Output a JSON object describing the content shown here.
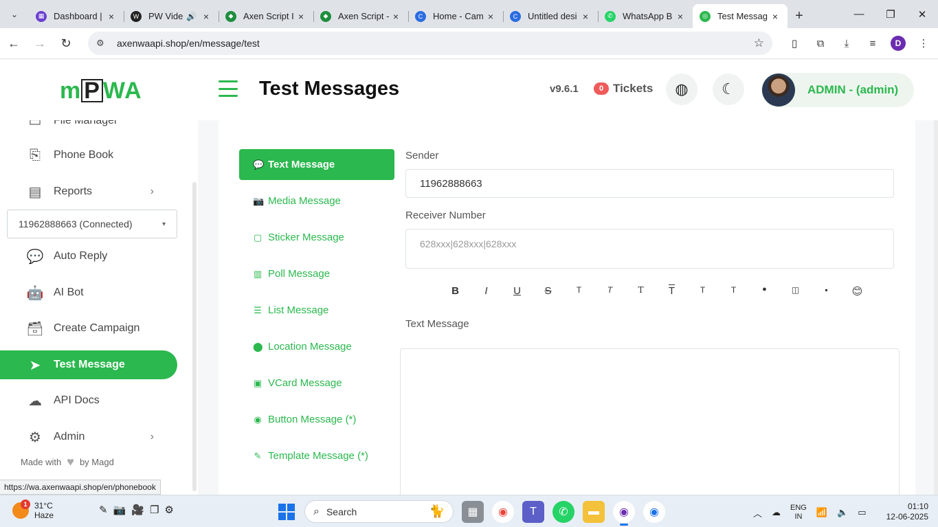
{
  "browser": {
    "tabs": [
      {
        "title": "Dashboard |",
        "color": "#6b3fd1",
        "glyph": "▦"
      },
      {
        "title": "PW Vide",
        "color": "#222222",
        "glyph": "W",
        "audio": "🔊"
      },
      {
        "title": "Axen Script I",
        "color": "#1e8e3e",
        "glyph": "◆"
      },
      {
        "title": "Axen Script -",
        "color": "#1e8e3e",
        "glyph": "◆"
      },
      {
        "title": "Home - Cam",
        "color": "#2b6de0",
        "glyph": "C"
      },
      {
        "title": "Untitled desi",
        "color": "#2b6de0",
        "glyph": "C"
      },
      {
        "title": "WhatsApp B",
        "color": "#25d366",
        "glyph": "✆"
      },
      {
        "title": "Test Messag",
        "color": "#2bb84e",
        "glyph": "◎"
      }
    ],
    "url": "axenwaapi.shop/en/message/test",
    "profile_letter": "D"
  },
  "header": {
    "logo_left": "m",
    "logo_boxed": "P",
    "logo_right": "WA",
    "title": "Test Messages",
    "version": "v9.6.1",
    "ticket_count": "0",
    "tickets_label": "Tickets",
    "user": "ADMIN - (admin)"
  },
  "sidebar": {
    "partial_item": "File Manager",
    "items": [
      {
        "label": "Phone Book",
        "icon": "phonebook-icon",
        "glyph": "⎘"
      },
      {
        "label": "Reports",
        "icon": "reports-icon",
        "glyph": "▤",
        "chevron": true
      },
      {
        "label": "Auto Reply",
        "icon": "chat-icon",
        "glyph": "💬"
      },
      {
        "label": "AI Bot",
        "icon": "robot-icon",
        "glyph": "🤖"
      },
      {
        "label": "Create Campaign",
        "icon": "archive-icon",
        "glyph": "🗃"
      },
      {
        "label": "Test Message",
        "icon": "send-icon",
        "glyph": "➤",
        "active": true
      },
      {
        "label": "API Docs",
        "icon": "cloud-download-icon",
        "glyph": "☁"
      },
      {
        "label": "Admin",
        "icon": "gear-icon",
        "glyph": "⚙",
        "chevron": true
      }
    ],
    "device": "11962888663 (Connected)",
    "made_with": "Made with",
    "by": "by Magd"
  },
  "menu": [
    {
      "label": "Text Message",
      "glyph": "💬",
      "active": true
    },
    {
      "label": "Media Message",
      "glyph": "📷"
    },
    {
      "label": "Sticker Message",
      "glyph": "▢"
    },
    {
      "label": "Poll Message",
      "glyph": "▥"
    },
    {
      "label": "List Message",
      "glyph": "☰"
    },
    {
      "label": "Location Message",
      "glyph": "⬤"
    },
    {
      "label": "VCard Message",
      "glyph": "▣"
    },
    {
      "label": "Button Message (*)",
      "glyph": "◉"
    },
    {
      "label": "Template Message (*)",
      "glyph": "✎"
    }
  ],
  "form": {
    "sender_label": "Sender",
    "sender_value": "11962888663",
    "receiver_label": "Receiver Number",
    "receiver_placeholder": "628xxx|628xxx|628xxx",
    "text_label": "Text Message",
    "format_buttons": [
      "B",
      "I",
      "U",
      "S",
      "T",
      "T",
      "T",
      "T",
      "T",
      "T",
      "●",
      "◫",
      "▪",
      "😊"
    ]
  },
  "status_url": "https://wa.axenwaapi.shop/en/phonebook",
  "taskbar": {
    "weather_badge": "1",
    "temp": "31°C",
    "condition": "Haze",
    "search": "Search",
    "lang1": "ENG",
    "lang2": "IN",
    "time": "01:10",
    "date": "12-06-2025"
  }
}
